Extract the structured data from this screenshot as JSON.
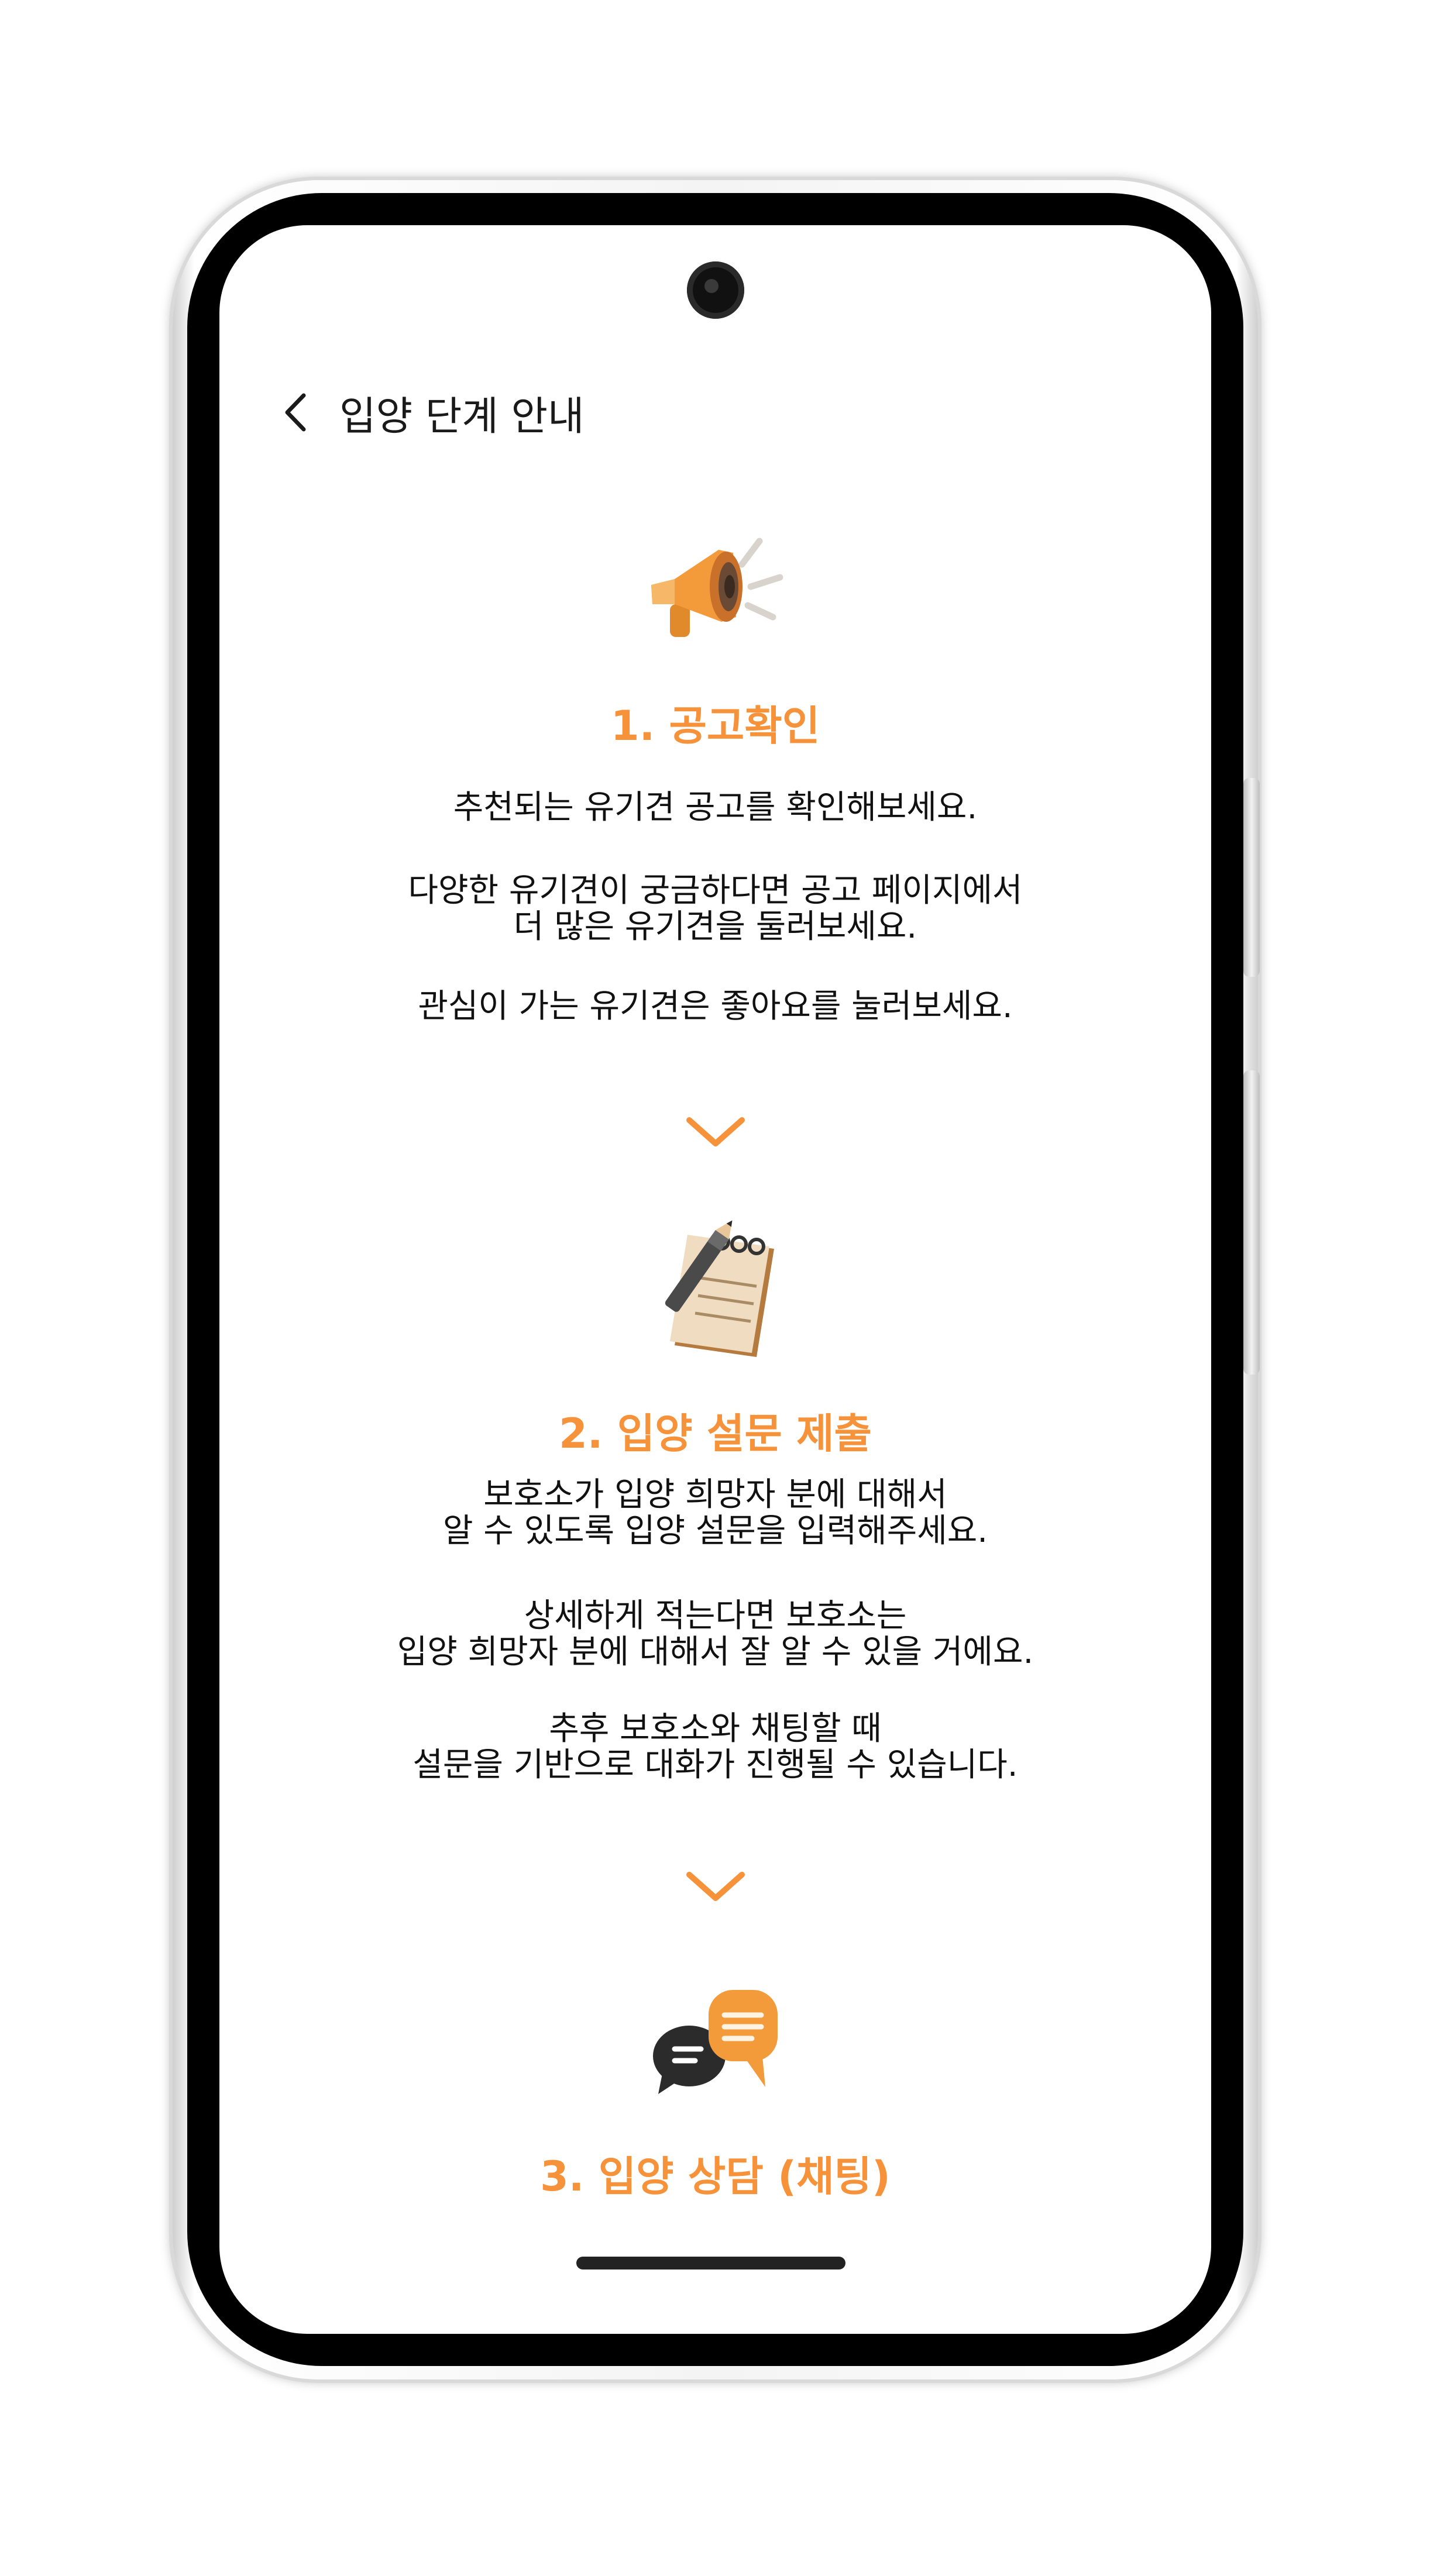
{
  "header": {
    "title": "입양 단계 안내"
  },
  "steps": [
    {
      "icon": "megaphone-icon",
      "title": "1. 공고확인",
      "paragraphs": [
        [
          "추천되는 유기견 공고를 확인해보세요."
        ],
        [
          "다양한 유기견이 궁금하다면 공고 페이지에서",
          "더 많은 유기견을 둘러보세요."
        ],
        [
          "관심이 가는 유기견은 좋아요를 눌러보세요."
        ]
      ]
    },
    {
      "icon": "notepad-pencil-icon",
      "title": "2. 입양 설문 제출",
      "paragraphs": [
        [
          "보호소가 입양 희망자 분에 대해서",
          "알 수 있도록 입양 설문을 입력해주세요."
        ],
        [
          "상세하게 적는다면 보호소는",
          "입양 희망자 분에 대해서 잘 알 수 있을 거에요."
        ],
        [
          "추후 보호소와 채팅할 때",
          "설문을 기반으로 대화가 진행될 수 있습니다."
        ]
      ]
    },
    {
      "icon": "chat-bubbles-icon",
      "title": "3. 입양 상담 (채팅)"
    }
  ],
  "colors": {
    "accent": "#f6923a",
    "text": "#111111",
    "frame": "#000000"
  }
}
